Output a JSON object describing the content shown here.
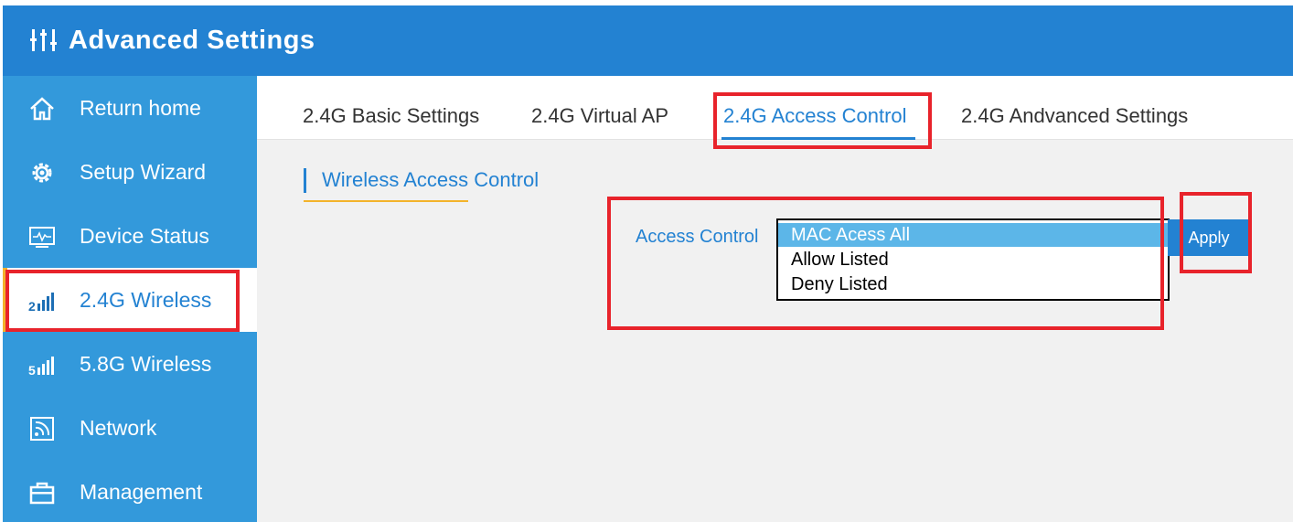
{
  "header": {
    "title": "Advanced Settings",
    "icon": "sliders-icon",
    "background": "#2382d2"
  },
  "sidebar": {
    "background": "#3399db",
    "items": [
      {
        "label": "Return home",
        "icon": "home-icon"
      },
      {
        "label": "Setup Wizard",
        "icon": "gear-icon"
      },
      {
        "label": "Device Status",
        "icon": "monitor-icon"
      },
      {
        "label": "2.4G Wireless",
        "icon": "signal-2g-icon",
        "active": true
      },
      {
        "label": "5.8G Wireless",
        "icon": "signal-5g-icon"
      },
      {
        "label": "Network",
        "icon": "network-icon"
      },
      {
        "label": "Management",
        "icon": "toolbox-icon"
      }
    ]
  },
  "tabs": [
    {
      "label": "2.4G Basic Settings"
    },
    {
      "label": "2.4G Virtual AP"
    },
    {
      "label": "2.4G Access Control",
      "active": true
    },
    {
      "label": "2.4G Andvanced Settings"
    }
  ],
  "section": {
    "title": "Wireless Access Control"
  },
  "access_control": {
    "label": "Access Control",
    "options": [
      "MAC Acess All",
      "Allow Listed",
      "Deny Listed"
    ],
    "selected": "MAC Acess All"
  },
  "apply_label": "Apply",
  "colors": {
    "accent": "#2382d2",
    "highlight": "#f3b32b",
    "annotation": "#e8232b",
    "selected_option": "#5cb6e8"
  }
}
